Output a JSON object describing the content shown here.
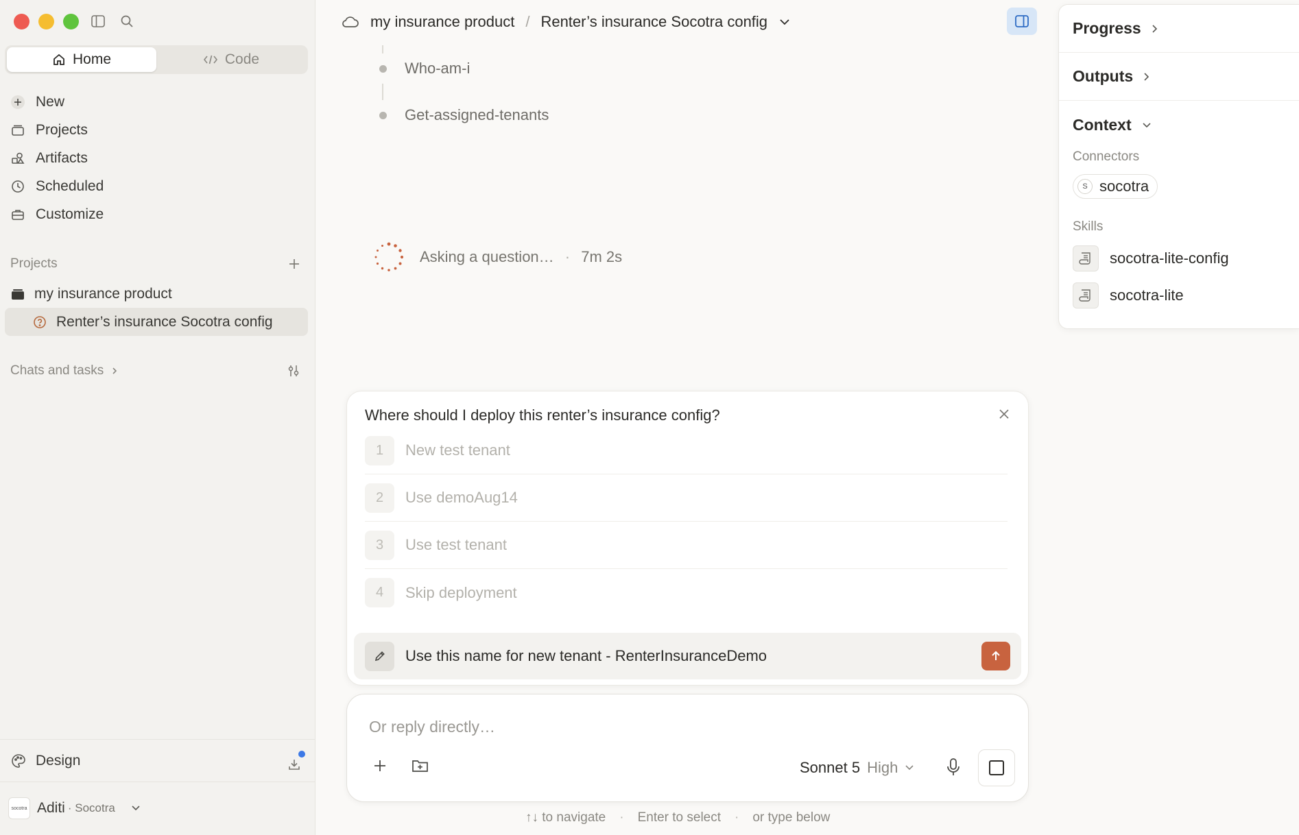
{
  "sidebar": {
    "tabs": [
      {
        "label": "Home",
        "icon": "home-icon"
      },
      {
        "label": "Code",
        "icon": "code-icon"
      }
    ],
    "nav": [
      {
        "label": "New",
        "icon": "plus-icon"
      },
      {
        "label": "Projects",
        "icon": "folder-icon"
      },
      {
        "label": "Artifacts",
        "icon": "shapes-icon"
      },
      {
        "label": "Scheduled",
        "icon": "clock-icon"
      },
      {
        "label": "Customize",
        "icon": "briefcase-icon"
      }
    ],
    "projects_heading": "Projects",
    "projects": [
      {
        "label": "my insurance product",
        "icon": "folder-filled-icon"
      },
      {
        "label": "Renter’s insurance Socotra config",
        "icon": "question-circle-icon"
      }
    ],
    "chats_heading": "Chats and tasks",
    "design_label": "Design",
    "user": {
      "name": "Aditi",
      "org": "· Socotra",
      "avatar_text": "socotra"
    }
  },
  "header": {
    "project": "my insurance product",
    "separator": "/",
    "task": "Renter’s insurance Socotra config"
  },
  "timeline": {
    "items": [
      "Who-am-i",
      "Get-assigned-tenants"
    ]
  },
  "status": {
    "text": "Asking a question…",
    "separator": "·",
    "elapsed": "7m 2s"
  },
  "question": {
    "title": "Where should I deploy this renter’s insurance config?",
    "options": [
      {
        "num": "1",
        "label": "New test tenant"
      },
      {
        "num": "2",
        "label": "Use demoAug14"
      },
      {
        "num": "3",
        "label": "Use test tenant"
      },
      {
        "num": "4",
        "label": "Skip deployment"
      }
    ],
    "custom_answer": "Use this name for new tenant - RenterInsuranceDemo"
  },
  "reply": {
    "placeholder": "Or reply directly…",
    "model": "Sonnet 5",
    "effort": "High"
  },
  "hints": {
    "navigate": "↑↓ to navigate",
    "select": "Enter to select",
    "type": "or type below",
    "dot": "·"
  },
  "right_panel": {
    "progress": "Progress",
    "outputs": "Outputs",
    "context": "Context",
    "connectors_label": "Connectors",
    "connector": {
      "badge": "S",
      "label": "socotra"
    },
    "skills_label": "Skills",
    "skills": [
      "socotra-lite-config",
      "socotra-lite"
    ]
  },
  "colors": {
    "accent_send": "#c8633f",
    "panel_toggle": "#d7e6f7",
    "notification": "#3c79e6"
  }
}
